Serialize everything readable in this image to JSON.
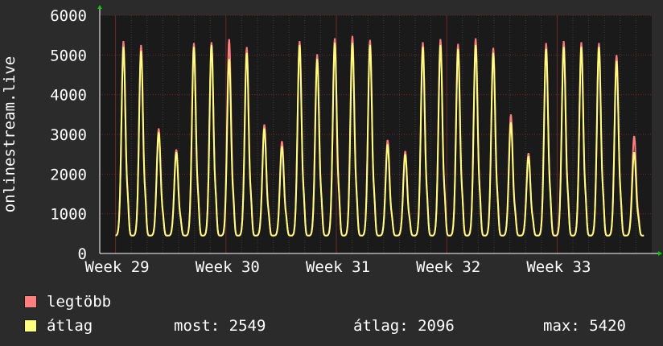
{
  "chart_data": {
    "type": "line",
    "ylabel": "onlinestream.live",
    "ylim": [
      0,
      6000
    ],
    "yticks": [
      0,
      1000,
      2000,
      3000,
      4000,
      5000,
      6000
    ],
    "xticks": [
      "Week 29",
      "Week 30",
      "Week 31",
      "Week 32",
      "Week 33"
    ],
    "x_days": [
      0,
      35
    ],
    "xtick_days": [
      1,
      8,
      15,
      22,
      29
    ],
    "grid": true,
    "daily_peaks": {
      "legtöbb": [
        5350,
        5250,
        3150,
        2620,
        5300,
        5320,
        5400,
        5200,
        3250,
        2830,
        5350,
        5020,
        5420,
        5480,
        5380,
        2860,
        2580,
        5320,
        5400,
        5280,
        5420,
        5180,
        3500,
        2530,
        5300,
        5350,
        5320,
        5300,
        5000,
        2960
      ],
      "átlag": [
        5200,
        5100,
        3050,
        2550,
        5200,
        5250,
        4900,
        5050,
        3150,
        2700,
        5250,
        4900,
        5300,
        5300,
        5250,
        2750,
        2500,
        5200,
        5250,
        5150,
        5250,
        5050,
        3300,
        2450,
        5150,
        5200,
        5200,
        5200,
        4850,
        2549
      ]
    },
    "daily_min": 450,
    "series": [
      {
        "name": "legtöbb",
        "color": "#ff7f7f"
      },
      {
        "name": "átlag",
        "color": "#ffff7f"
      }
    ]
  },
  "legend": {
    "max_label": "legtöbb",
    "avg_label": "átlag",
    "now_text": "most: 2549",
    "avg_text": "átlag: 2096",
    "max_text": "max: 5420"
  },
  "colors": {
    "background": "#2b2b2b",
    "plot_bg": "#1a1a1a",
    "grid_minor": "#3d3d3d",
    "grid_major": "#6a2a2a",
    "axis": "#ffffff"
  }
}
